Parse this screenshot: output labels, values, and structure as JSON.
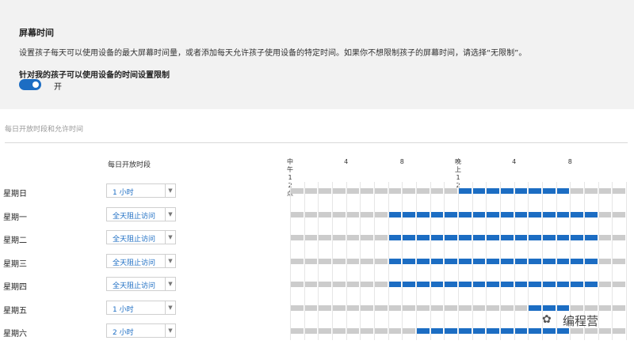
{
  "panel": {
    "title": "屏幕时间",
    "description": "设置孩子每天可以使用设备的最大屏幕时间量，或者添加每天允许孩子使用设备的特定时间。如果你不想限制孩子的屏幕时间，请选择“无限制”。",
    "limit_label": "针对我的孩子可以使用设备的时间设置限制",
    "toggle_state": "开",
    "toggle_on": true
  },
  "section_title": "每日开放时段和允许时间",
  "column_header": "每日开放时段",
  "time_axis": {
    "ticks": [
      {
        "label": "中午12点",
        "hour": 0
      },
      {
        "label": "4",
        "hour": 4
      },
      {
        "label": "8",
        "hour": 8
      },
      {
        "label": "晚上12",
        "hour": 12
      },
      {
        "label": "4",
        "hour": 16
      },
      {
        "label": "8",
        "hour": 20
      }
    ],
    "total_hours": 24,
    "slots": 24
  },
  "days": [
    {
      "name": "星期日",
      "limit": "1 小时",
      "allowed": [
        12,
        20
      ]
    },
    {
      "name": "星期一",
      "limit": "全天阻止访问",
      "allowed": [
        7,
        22
      ]
    },
    {
      "name": "星期二",
      "limit": "全天阻止访问",
      "allowed": [
        7,
        22
      ]
    },
    {
      "name": "星期三",
      "limit": "全天阻止访问",
      "allowed": [
        7,
        22
      ]
    },
    {
      "name": "星期四",
      "limit": "全天阻止访问",
      "allowed": [
        7,
        22
      ]
    },
    {
      "name": "星期五",
      "limit": "1 小时",
      "allowed": [
        17,
        20
      ]
    },
    {
      "name": "星期六",
      "limit": "2 小时",
      "allowed": [
        9,
        20
      ]
    }
  ],
  "colors": {
    "allowed": "#1c6dc3",
    "blocked": "#cccccc",
    "accent": "#1c6dc3"
  },
  "watermark": {
    "text": "编程营",
    "icon": "wechat-icon"
  }
}
